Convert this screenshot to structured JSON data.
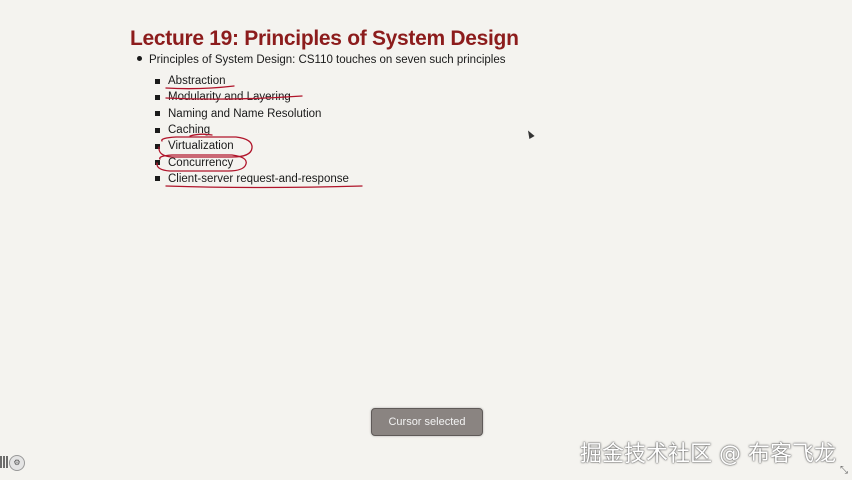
{
  "slide": {
    "title": "Lecture 19: Principles of System Design",
    "bullet": "Principles of System Design: CS110 touches on seven such principles",
    "principles": [
      "Abstraction",
      "Modularity and Layering",
      "Naming and Name Resolution",
      "Caching",
      "Virtualization",
      "Concurrency",
      "Client-server request-and-response"
    ]
  },
  "toast": {
    "text": "Cursor selected"
  },
  "watermark": {
    "text": "掘金技术社区 @ 布客飞龙"
  },
  "icons": {
    "cursor": "cursor-arrow-icon",
    "settings": "gear-icon",
    "resize": "resize-grip-icon"
  },
  "colors": {
    "title": "#8c1c1c",
    "ink": "#b0142a",
    "background": "#f4f3ef",
    "toast": "#8a8481"
  }
}
